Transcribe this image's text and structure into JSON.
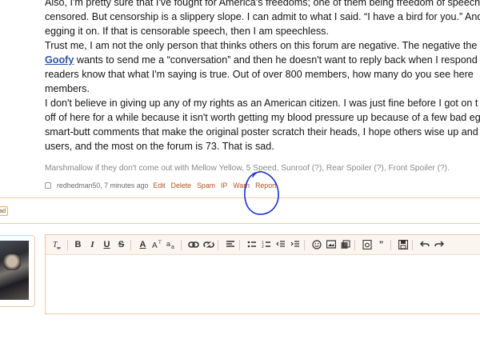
{
  "post": {
    "lines": [
      "Also, I'm pretty sure that I've fought for America's freedoms; one of them being freedom of speech",
      "censored. But censorship is a slippery slope. I can admit to what I said. “I have a bird for you.” And",
      "egging it on. If that is censorable speech, then I am speechless.",
      "Trust me, I am not the only person that thinks others on this forum are negative. The negative the",
      "wants to send me a “conversation” and then he doesn't want to reply back when I respond",
      "readers know that what I'm saying is true. Out of over 800 members, how many do you see here",
      "members.",
      "I don't believe in giving up any of my rights as an American citizen. I was just fine before I got on t",
      "off of here for a while because it isn't worth getting my blood pressure up because of a few bad eg",
      "smart-butt comments that make the original poster scratch their heads, I hope others wise up and",
      "users, and the most on the forum is 73. That is sad."
    ],
    "mention": "Goofy"
  },
  "signature": "Marshmallow if they don't come out with Mellow Yellow, 5 Speed, Sunroof (?), Rear Spoiler (?), Front Spoiler (?).",
  "meta": {
    "author": "redhedman50",
    "time": ", 7 minutes ago",
    "actions": [
      "Edit",
      "Delete",
      "Spam",
      "IP",
      "Warn",
      "Report"
    ]
  },
  "left_tag": "ad",
  "editor": {
    "toolbar_icons": [
      "remove-format-icon",
      "bold-icon",
      "italic-icon",
      "underline-icon",
      "strikethrough-icon",
      "text-color-icon",
      "font-size-icon",
      "font-family-icon",
      "link-icon",
      "unlink-icon",
      "align-icon",
      "bulleted-list-icon",
      "numbered-list-icon",
      "outdent-icon",
      "indent-icon",
      "smilie-icon",
      "image-icon",
      "media-icon",
      "code-icon",
      "quote-icon",
      "save-draft-icon",
      "undo-icon",
      "redo-icon"
    ]
  },
  "annotation_color": "#1b2fc9"
}
